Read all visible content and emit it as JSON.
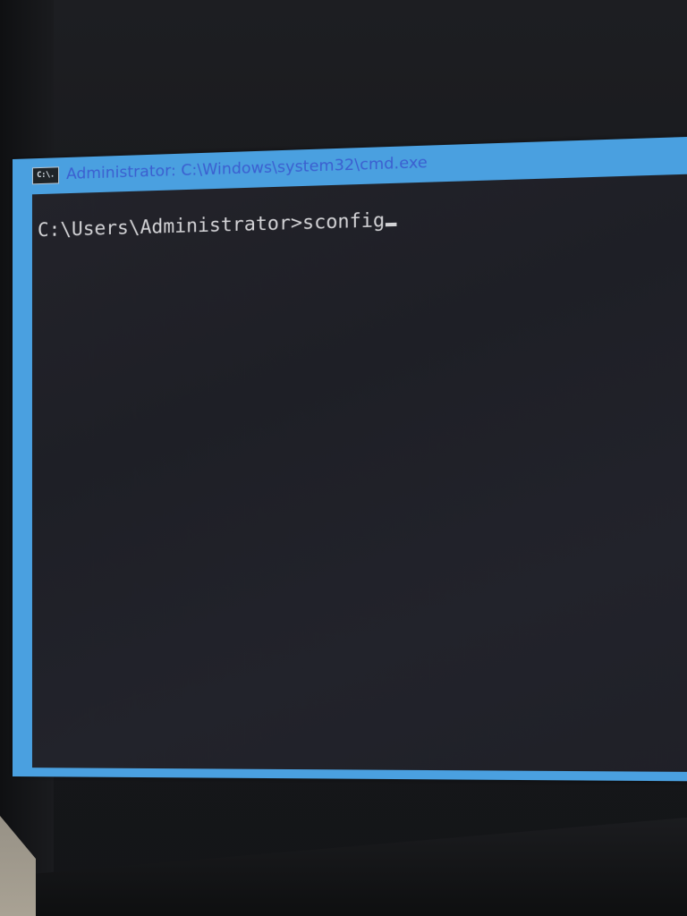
{
  "window": {
    "title": "Administrator: C:\\Windows\\system32\\cmd.exe",
    "icon_label": "C:\\."
  },
  "console": {
    "prompt": "C:\\Users\\Administrator>",
    "command": "sconfig"
  },
  "colors": {
    "frame_accent": "#4aa0e0",
    "title_text": "#3b5fd0",
    "console_bg": "#1f2027",
    "console_text": "#d3d3d6"
  },
  "icons": {
    "titlebar": "cmd-console-icon"
  }
}
